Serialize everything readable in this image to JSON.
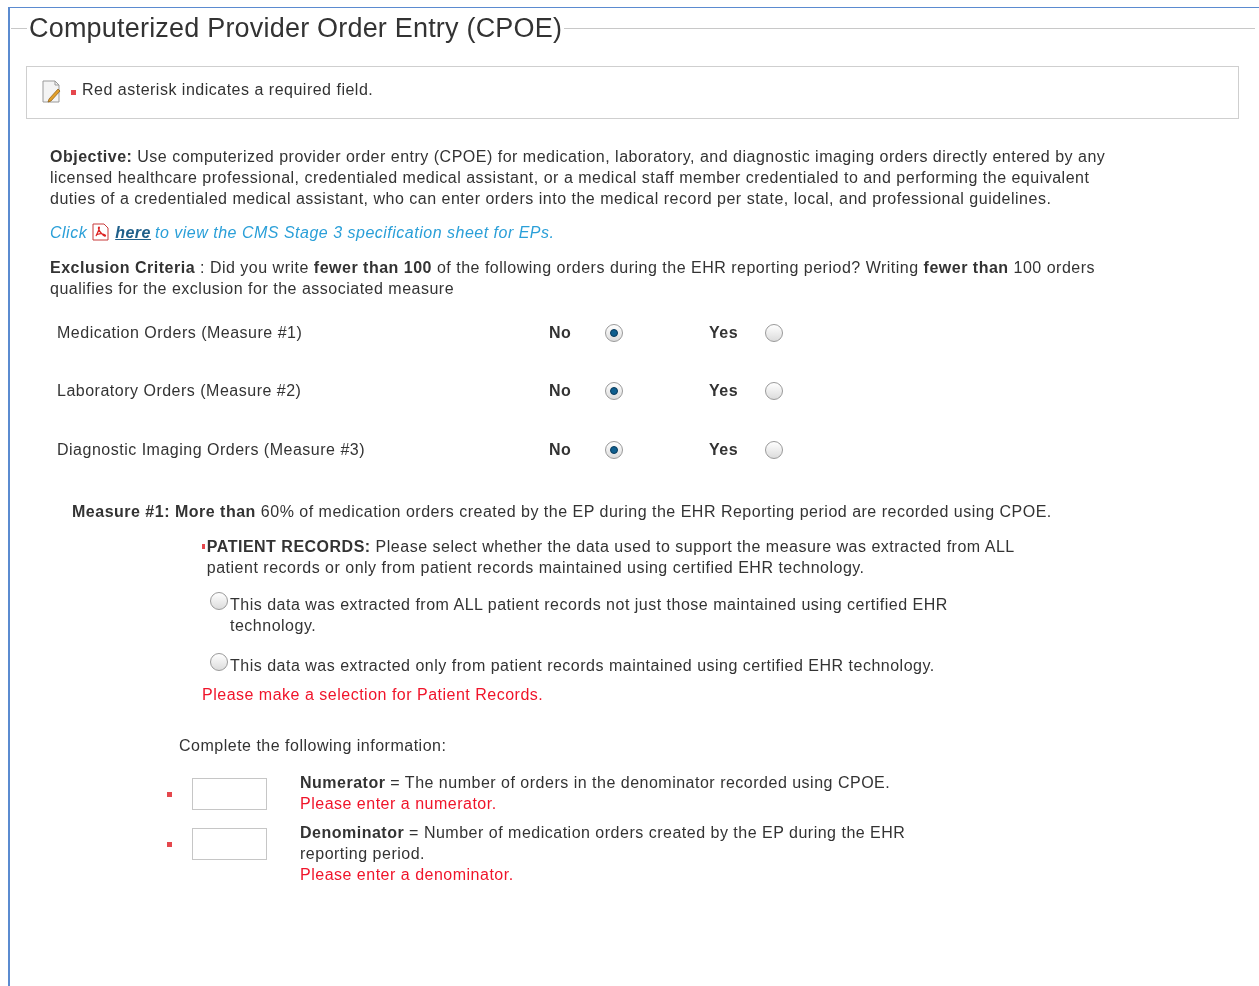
{
  "legend": "Computerized Provider Order Entry (CPOE)",
  "notice": {
    "required_marker": true,
    "text": "Red asterisk indicates a required field."
  },
  "objective": "**Objective:** Use computerized provider order entry (CPOE) for medication, laboratory, and diagnostic imaging orders directly entered by any licensed healthcare professional, credentialed medical assistant, or a medical staff member credentialed to and performing the equivalent duties of a credentialed medical assistant, who can enter orders into the medical record per state, local, and professional guidelines.",
  "spec_link": {
    "before": "Click",
    "link": "here",
    "after": "to view the CMS Stage 3 specification sheet for EPs."
  },
  "exclusion": "**Exclusion Criteria** : Did you write **fewer than 100** of the following orders during the EHR reporting period? Writing **fewer than** 100 orders qualifies for the exclusion for the associated measure",
  "exclusions": [
    {
      "label": "Medication Orders (Measure #1)",
      "options": [
        {
          "label": "No",
          "selected": true
        },
        {
          "label": "Yes",
          "selected": false
        }
      ]
    },
    {
      "label": "Laboratory Orders (Measure #2)",
      "options": [
        {
          "label": "No",
          "selected": true
        },
        {
          "label": "Yes",
          "selected": false
        }
      ]
    },
    {
      "label": "Diagnostic Imaging Orders (Measure #3)",
      "options": [
        {
          "label": "No",
          "selected": true
        },
        {
          "label": "Yes",
          "selected": false
        }
      ]
    }
  ],
  "measure": "**Measure #1: More than** 60% of medication orders created by the EP during the EHR Reporting period are recorded using CPOE.",
  "patient_records": {
    "required": true,
    "prompt": "**PATIENT RECORDS:** Please select whether the data used to support the measure was extracted from ALL patient records or only from patient records maintained using certified EHR technology.",
    "options": [
      {
        "label": "This data was extracted from ALL patient records not just those maintained using certified EHR technology.",
        "selected": false
      },
      {
        "label": "This data was extracted only from patient records maintained using certified EHR technology.",
        "selected": false
      }
    ],
    "error": "Please make a selection for Patient Records."
  },
  "complete_prompt": "Complete the following information:",
  "fields": [
    {
      "required": true,
      "description": "**Numerator** = The number of orders in the denominator recorded using CPOE.",
      "error": "Please enter a numerator."
    },
    {
      "required": true,
      "description": "**Denominator** = Number of medication orders created by the EP during the EHR reporting period.",
      "error": "Please enter a denominator."
    }
  ]
}
